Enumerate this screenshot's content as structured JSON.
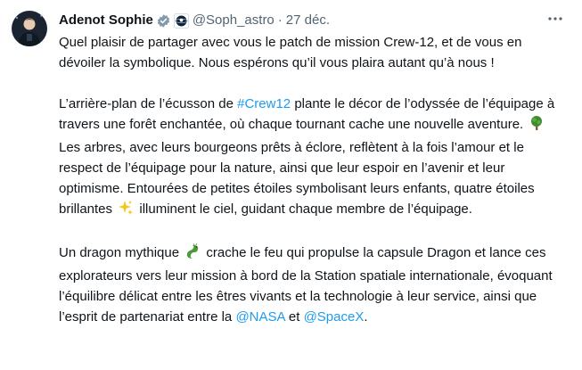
{
  "tweet": {
    "author": {
      "display_name": "Adenot Sophie",
      "handle": "@Soph_astro",
      "separator": "·",
      "date": "27 déc.",
      "verified_color": "#829aab",
      "avatar_icon": "person-avatar"
    },
    "more_icon": "more-horizontal-icon",
    "paragraph1": "Quel plaisir de partager avec vous le patch de mission Crew-12, et de vous en dévoiler la symbolique. Nous espérons qu’il vous plaira autant qu’à nous !",
    "paragraph2": {
      "before_hashtag": "L’arrière-plan de l’écusson de ",
      "hashtag": "#Crew12",
      "after_hashtag": " plante le décor de l’odyssée de l’équipage à travers une forêt enchantée, où chaque tournant cache une nouvelle aventure.",
      "after_tree": " Les arbres, avec leurs bourgeons prêts à éclore, reflètent à la fois l’amour et le respect de l’équipage pour la nature, ainsi que leur espoir en l’avenir et leur optimisme. Entourées de petites étoiles symbolisant leurs enfants, quatre étoiles brillantes",
      "after_sparkles": " illuminent le ciel, guidant chaque membre de l’équipage."
    },
    "paragraph3": {
      "before_dragon": "Un dragon mythique",
      "after_dragon": " crache le feu qui propulse la capsule Dragon et lance ces explorateurs vers leur mission à bord de la Station spatiale internationale, évoquant l’équilibre délicat entre les êtres vivants et la technologie à leur service, ainsi que l’esprit de partenariat entre la ",
      "mention1": "@NASA",
      "between": " et ",
      "mention2": "@SpaceX",
      "end": "."
    },
    "emojis": [
      "tree-emoji",
      "sparkles-emoji",
      "dragon-emoji"
    ],
    "link_color": "#1d9bf0"
  }
}
